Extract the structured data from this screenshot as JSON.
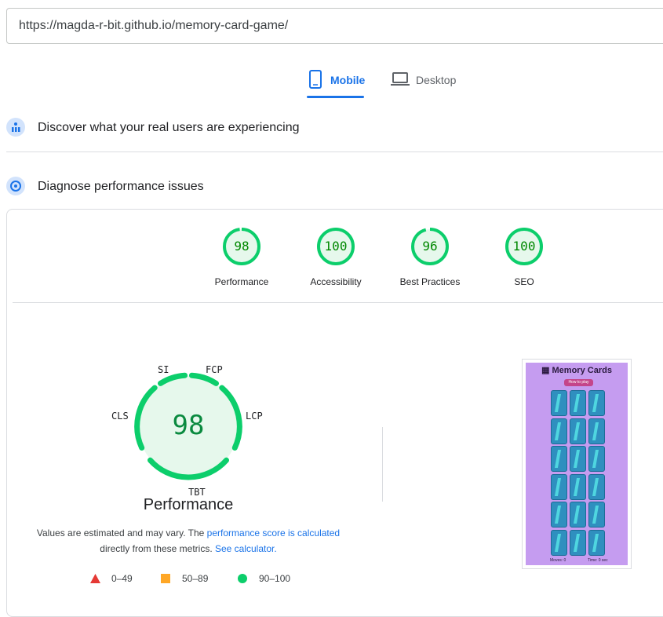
{
  "url": "https://magda-r-bit.github.io/memory-card-game/",
  "tabs": [
    {
      "label": "Mobile",
      "icon": "phone-icon",
      "active": true
    },
    {
      "label": "Desktop",
      "icon": "laptop-icon",
      "active": false
    }
  ],
  "sections": {
    "real_users": "Discover what your real users are experiencing",
    "diagnose": "Diagnose performance issues"
  },
  "category_scores": [
    {
      "label": "Performance",
      "score": "98"
    },
    {
      "label": "Accessibility",
      "score": "100"
    },
    {
      "label": "Best Practices",
      "score": "96"
    },
    {
      "label": "SEO",
      "score": "100"
    }
  ],
  "performance": {
    "score": "98",
    "title": "Performance",
    "metrics": {
      "si": "SI",
      "fcp": "FCP",
      "lcp": "LCP",
      "tbt": "TBT",
      "cls": "CLS"
    },
    "note_1_prefix": "Values are estimated and may vary. The ",
    "note_1_link": "performance score is calculated",
    "note_2_prefix": "directly from these metrics. ",
    "note_2_link": "See calculator."
  },
  "legend": [
    {
      "range": "0–49",
      "shape": "triangle",
      "color": "#e53935"
    },
    {
      "range": "50–89",
      "shape": "square",
      "color": "#ffa726"
    },
    {
      "range": "90–100",
      "shape": "circle",
      "color": "#0cce6b"
    }
  ],
  "colors": {
    "accent": "#1a73e8",
    "pass": "#0cce6b",
    "pass_text": "#008800"
  },
  "screenshot": {
    "title": "Memory Cards",
    "button": "How to play",
    "moves": "Moves: 0",
    "time": "Time: 0 sec"
  }
}
